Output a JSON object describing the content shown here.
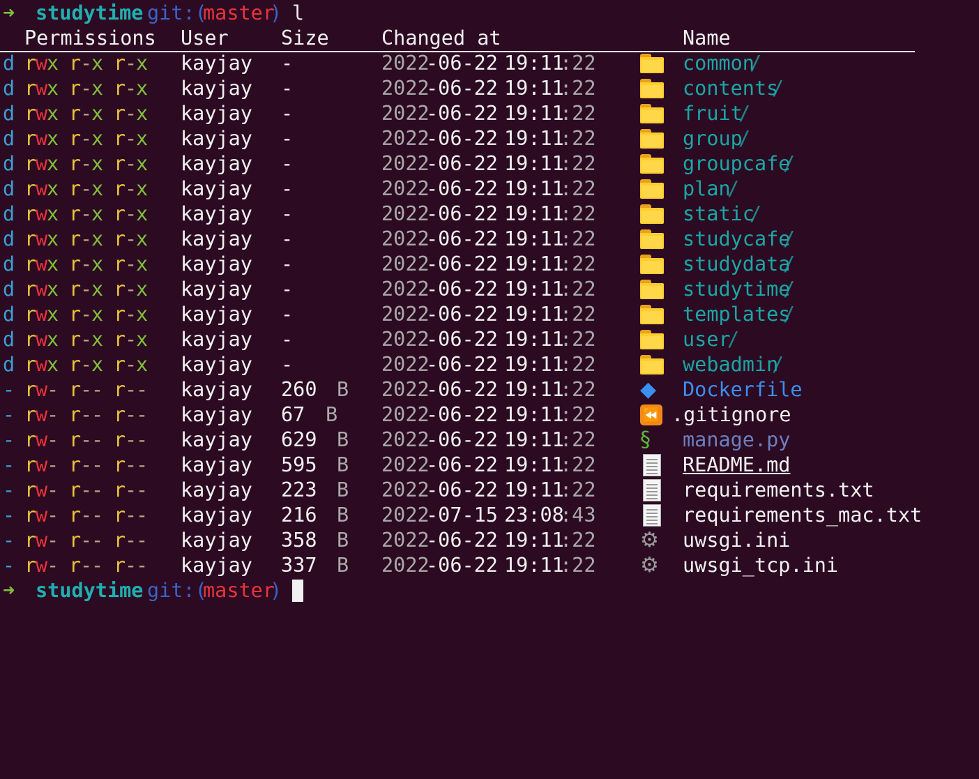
{
  "prompt": {
    "arrow": "➜",
    "dir": "studytime",
    "git_open": "git:(",
    "branch": "master",
    "git_close": ")",
    "command": "l"
  },
  "header": {
    "permissions": "Permissions",
    "user": "User",
    "size": "Size",
    "changed": "Changed at",
    "name": "Name"
  },
  "rows": [
    {
      "type": "d",
      "perm": [
        "r",
        "w",
        "x",
        "r",
        "-",
        "x",
        "r",
        "-",
        "x"
      ],
      "user": "kayjay",
      "size": "-",
      "unit": "",
      "date": "2022",
      "md": "-06-22",
      "hm": "19:11",
      "sec": ":22",
      "icon": "folder-icon",
      "name": "common",
      "suffix": "/",
      "kind": "dir"
    },
    {
      "type": "d",
      "perm": [
        "r",
        "w",
        "x",
        "r",
        "-",
        "x",
        "r",
        "-",
        "x"
      ],
      "user": "kayjay",
      "size": "-",
      "unit": "",
      "date": "2022",
      "md": "-06-22",
      "hm": "19:11",
      "sec": ":22",
      "icon": "folder-icon",
      "name": "contents",
      "suffix": "/",
      "kind": "dir"
    },
    {
      "type": "d",
      "perm": [
        "r",
        "w",
        "x",
        "r",
        "-",
        "x",
        "r",
        "-",
        "x"
      ],
      "user": "kayjay",
      "size": "-",
      "unit": "",
      "date": "2022",
      "md": "-06-22",
      "hm": "19:11",
      "sec": ":22",
      "icon": "folder-icon",
      "name": "fruit",
      "suffix": "/",
      "kind": "dir"
    },
    {
      "type": "d",
      "perm": [
        "r",
        "w",
        "x",
        "r",
        "-",
        "x",
        "r",
        "-",
        "x"
      ],
      "user": "kayjay",
      "size": "-",
      "unit": "",
      "date": "2022",
      "md": "-06-22",
      "hm": "19:11",
      "sec": ":22",
      "icon": "folder-icon",
      "name": "group",
      "suffix": "/",
      "kind": "dir"
    },
    {
      "type": "d",
      "perm": [
        "r",
        "w",
        "x",
        "r",
        "-",
        "x",
        "r",
        "-",
        "x"
      ],
      "user": "kayjay",
      "size": "-",
      "unit": "",
      "date": "2022",
      "md": "-06-22",
      "hm": "19:11",
      "sec": ":22",
      "icon": "folder-icon",
      "name": "groupcafe",
      "suffix": "/",
      "kind": "dir"
    },
    {
      "type": "d",
      "perm": [
        "r",
        "w",
        "x",
        "r",
        "-",
        "x",
        "r",
        "-",
        "x"
      ],
      "user": "kayjay",
      "size": "-",
      "unit": "",
      "date": "2022",
      "md": "-06-22",
      "hm": "19:11",
      "sec": ":22",
      "icon": "folder-icon",
      "name": "plan",
      "suffix": "/",
      "kind": "dir"
    },
    {
      "type": "d",
      "perm": [
        "r",
        "w",
        "x",
        "r",
        "-",
        "x",
        "r",
        "-",
        "x"
      ],
      "user": "kayjay",
      "size": "-",
      "unit": "",
      "date": "2022",
      "md": "-06-22",
      "hm": "19:11",
      "sec": ":22",
      "icon": "folder-icon",
      "name": "static",
      "suffix": "/",
      "kind": "dir"
    },
    {
      "type": "d",
      "perm": [
        "r",
        "w",
        "x",
        "r",
        "-",
        "x",
        "r",
        "-",
        "x"
      ],
      "user": "kayjay",
      "size": "-",
      "unit": "",
      "date": "2022",
      "md": "-06-22",
      "hm": "19:11",
      "sec": ":22",
      "icon": "folder-icon",
      "name": "studycafe",
      "suffix": "/",
      "kind": "dir"
    },
    {
      "type": "d",
      "perm": [
        "r",
        "w",
        "x",
        "r",
        "-",
        "x",
        "r",
        "-",
        "x"
      ],
      "user": "kayjay",
      "size": "-",
      "unit": "",
      "date": "2022",
      "md": "-06-22",
      "hm": "19:11",
      "sec": ":22",
      "icon": "folder-icon",
      "name": "studydata",
      "suffix": "/",
      "kind": "dir"
    },
    {
      "type": "d",
      "perm": [
        "r",
        "w",
        "x",
        "r",
        "-",
        "x",
        "r",
        "-",
        "x"
      ],
      "user": "kayjay",
      "size": "-",
      "unit": "",
      "date": "2022",
      "md": "-06-22",
      "hm": "19:11",
      "sec": ":22",
      "icon": "folder-icon",
      "name": "studytime",
      "suffix": "/",
      "kind": "dir"
    },
    {
      "type": "d",
      "perm": [
        "r",
        "w",
        "x",
        "r",
        "-",
        "x",
        "r",
        "-",
        "x"
      ],
      "user": "kayjay",
      "size": "-",
      "unit": "",
      "date": "2022",
      "md": "-06-22",
      "hm": "19:11",
      "sec": ":22",
      "icon": "folder-icon",
      "name": "templates",
      "suffix": "/",
      "kind": "dir"
    },
    {
      "type": "d",
      "perm": [
        "r",
        "w",
        "x",
        "r",
        "-",
        "x",
        "r",
        "-",
        "x"
      ],
      "user": "kayjay",
      "size": "-",
      "unit": "",
      "date": "2022",
      "md": "-06-22",
      "hm": "19:11",
      "sec": ":22",
      "icon": "folder-icon",
      "name": "user",
      "suffix": "/",
      "kind": "dir"
    },
    {
      "type": "d",
      "perm": [
        "r",
        "w",
        "x",
        "r",
        "-",
        "x",
        "r",
        "-",
        "x"
      ],
      "user": "kayjay",
      "size": "-",
      "unit": "",
      "date": "2022",
      "md": "-06-22",
      "hm": "19:11",
      "sec": ":22",
      "icon": "folder-icon",
      "name": "webadmin",
      "suffix": "/",
      "kind": "dir"
    },
    {
      "type": "-",
      "perm": [
        "r",
        "w",
        "-",
        "r",
        "-",
        "-",
        "r",
        "-",
        "-"
      ],
      "user": "kayjay",
      "size": "260",
      "unit": "B",
      "date": "2022",
      "md": "-06-22",
      "hm": "19:11",
      "sec": ":22",
      "icon": "whale-icon",
      "name": "Dockerfile",
      "suffix": "",
      "kind": "docker"
    },
    {
      "type": "-",
      "perm": [
        "r",
        "w",
        "-",
        "r",
        "-",
        "-",
        "r",
        "-",
        "-"
      ],
      "user": "kayjay",
      "size": "67",
      "unit": "B",
      "date": "2022",
      "md": "-06-22",
      "hm": "19:11",
      "sec": ":22",
      "icon": "rewind-icon",
      "name": ".gitignore",
      "suffix": "",
      "kind": "git"
    },
    {
      "type": "-",
      "perm": [
        "r",
        "w",
        "-",
        "r",
        "-",
        "-",
        "r",
        "-",
        "-"
      ],
      "user": "kayjay",
      "size": "629",
      "unit": "B",
      "date": "2022",
      "md": "-06-22",
      "hm": "19:11",
      "sec": ":22",
      "icon": "snake-icon",
      "name": "manage.py",
      "suffix": "",
      "kind": "py"
    },
    {
      "type": "-",
      "perm": [
        "r",
        "w",
        "-",
        "r",
        "-",
        "-",
        "r",
        "-",
        "-"
      ],
      "user": "kayjay",
      "size": "595",
      "unit": "B",
      "date": "2022",
      "md": "-06-22",
      "hm": "19:11",
      "sec": ":22",
      "icon": "document-icon",
      "name": "README.md",
      "suffix": "",
      "kind": "readme"
    },
    {
      "type": "-",
      "perm": [
        "r",
        "w",
        "-",
        "r",
        "-",
        "-",
        "r",
        "-",
        "-"
      ],
      "user": "kayjay",
      "size": "223",
      "unit": "B",
      "date": "2022",
      "md": "-06-22",
      "hm": "19:11",
      "sec": ":22",
      "icon": "document-icon",
      "name": "requirements.txt",
      "suffix": "",
      "kind": "file"
    },
    {
      "type": "-",
      "perm": [
        "r",
        "w",
        "-",
        "r",
        "-",
        "-",
        "r",
        "-",
        "-"
      ],
      "user": "kayjay",
      "size": "216",
      "unit": "B",
      "date": "2022",
      "md": "-07-15",
      "hm": "23:08",
      "sec": ":43",
      "icon": "document-icon",
      "name": "requirements_mac.txt",
      "suffix": "",
      "kind": "file"
    },
    {
      "type": "-",
      "perm": [
        "r",
        "w",
        "-",
        "r",
        "-",
        "-",
        "r",
        "-",
        "-"
      ],
      "user": "kayjay",
      "size": "358",
      "unit": "B",
      "date": "2022",
      "md": "-06-22",
      "hm": "19:11",
      "sec": ":22",
      "icon": "gear-icon",
      "name": "uwsgi.ini",
      "suffix": "",
      "kind": "file"
    },
    {
      "type": "-",
      "perm": [
        "r",
        "w",
        "-",
        "r",
        "-",
        "-",
        "r",
        "-",
        "-"
      ],
      "user": "kayjay",
      "size": "337",
      "unit": "B",
      "date": "2022",
      "md": "-06-22",
      "hm": "19:11",
      "sec": ":22",
      "icon": "gear-icon",
      "name": "uwsgi_tcp.ini",
      "suffix": "",
      "kind": "file"
    }
  ],
  "colors": {
    "background": "#2c0a22",
    "prompt_arrow": "#7fbf3a",
    "prompt_dir": "#1fb0b0",
    "branch": "#e8343a",
    "directory": "#1aa6a6"
  }
}
